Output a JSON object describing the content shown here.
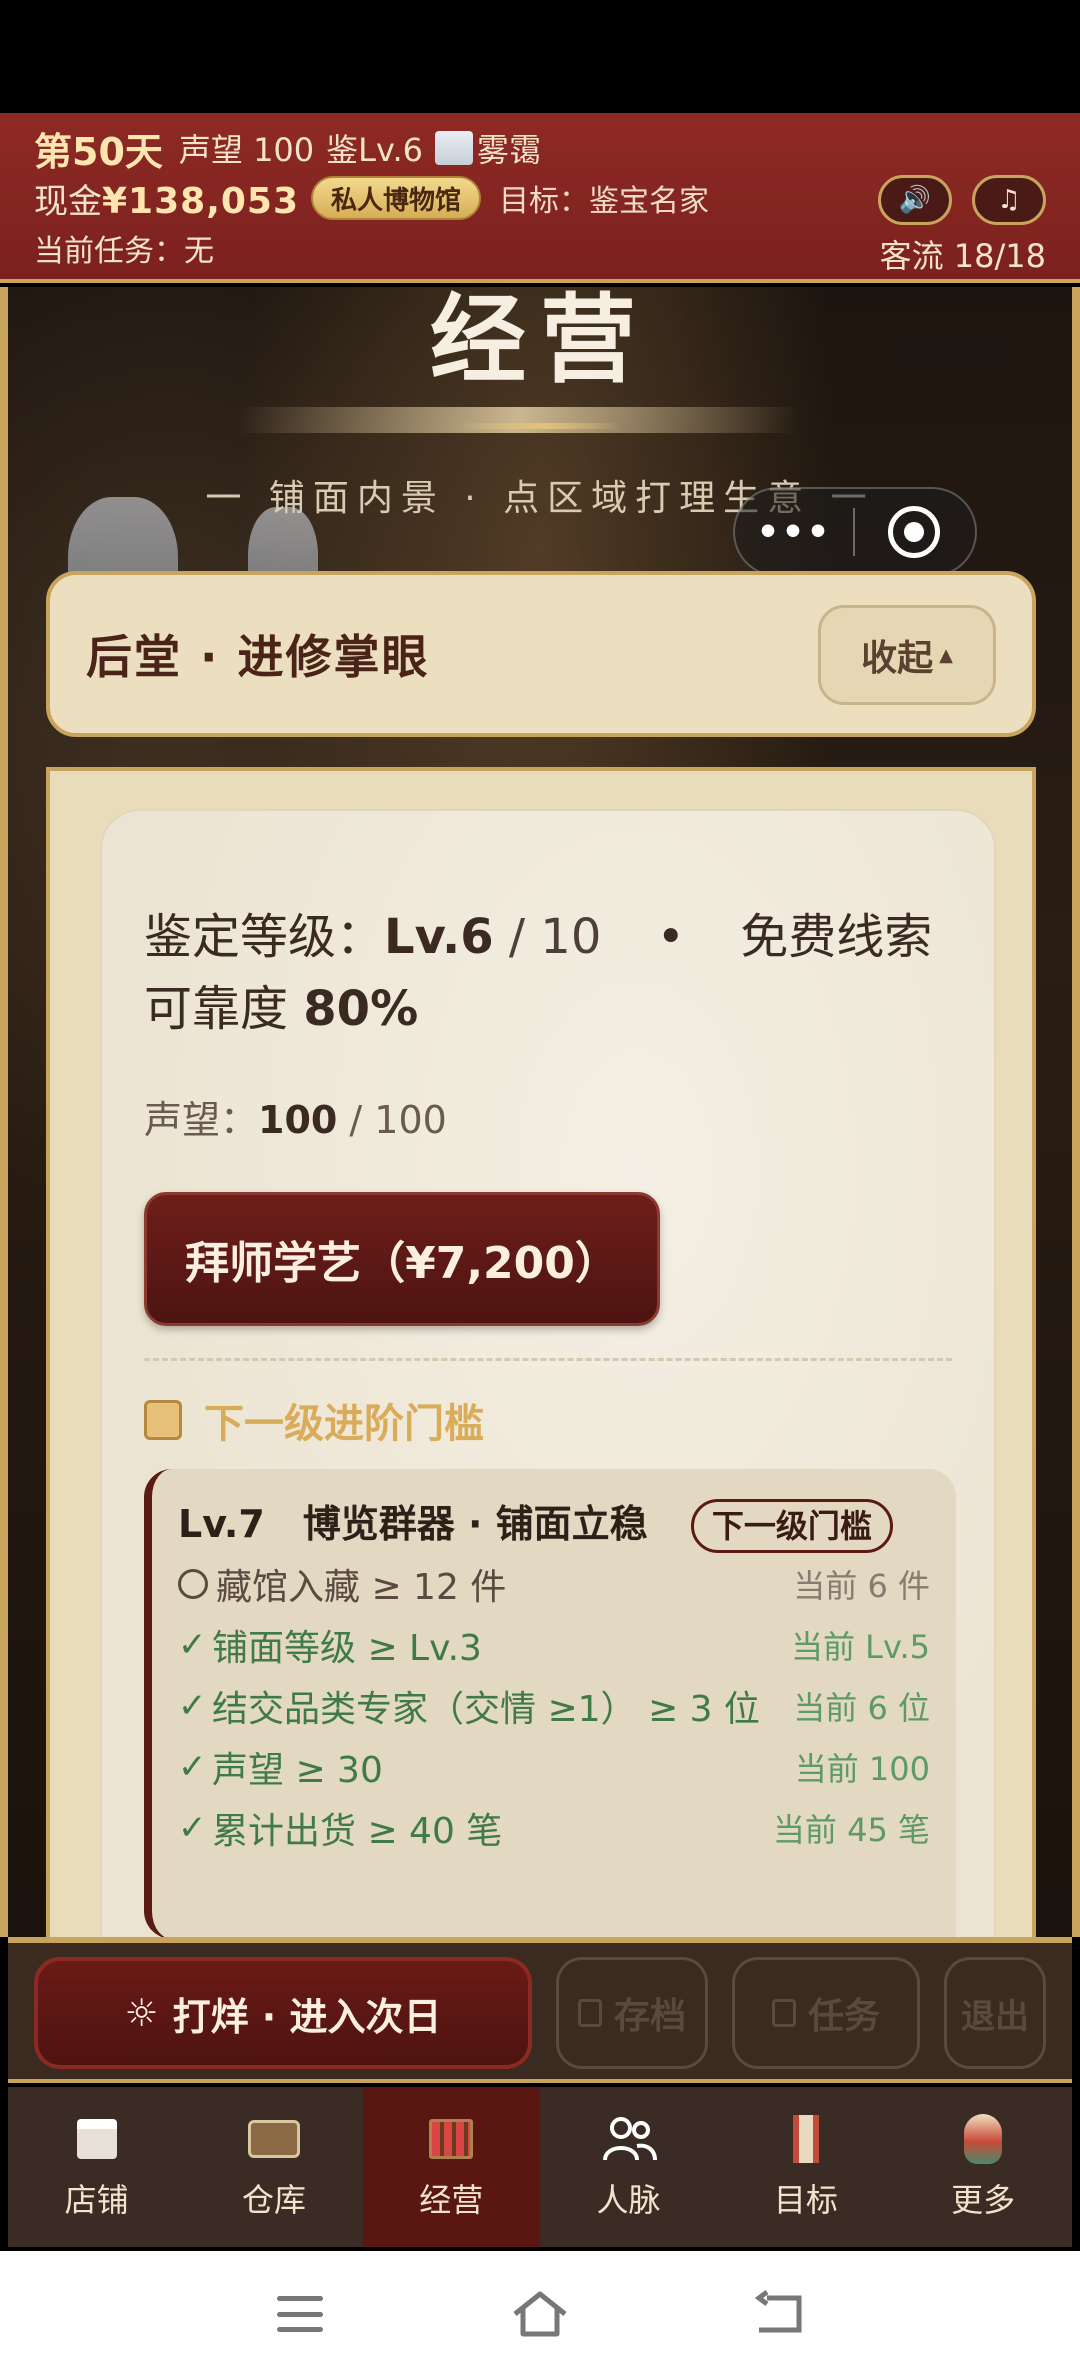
{
  "topbar": {
    "day": "第50天",
    "reputation": "声望 100",
    "appraise_level": "鉴Lv.6",
    "weather": "雾霭",
    "cash_label": "现金",
    "cash_value": "¥138,053",
    "museum_badge": "私人博物馆",
    "goal": "目标：鉴宝名家",
    "task": "当前任务：无",
    "traffic": "客流 18/18",
    "sound_icon": "🔊",
    "music_icon": "♫"
  },
  "scene": {
    "title": "经营",
    "subtitle": "一 铺面内景 · 点区域打理生意 一",
    "capsule_more": "•••"
  },
  "section": {
    "title": "后堂 · 进修掌眼",
    "collapse_label": "收起",
    "collapse_arrow": "▲"
  },
  "card": {
    "level_label": "鉴定等级：",
    "level_value": "Lv.6",
    "level_max": " / 10",
    "bullet": "•",
    "clue": "免费线索",
    "reliability_label": "可靠度 ",
    "reliability_value": "80%",
    "rep_label": "声望：",
    "rep_value": "100",
    "rep_max": " / 100",
    "master_button": "拜师学艺（¥7,200）",
    "next_title": "下一级进阶门槛"
  },
  "threshold": {
    "head": "Lv.7　博览群器 · 铺面立稳",
    "badge": "下一级门槛",
    "requirements": [
      {
        "done": false,
        "label": "藏馆入藏 ≥ 12 件",
        "current": "当前 6 件"
      },
      {
        "done": true,
        "label": "铺面等级 ≥ Lv.3",
        "current": "当前 Lv.5"
      },
      {
        "done": true,
        "label": "结交品类专家（交情 ≥1） ≥ 3 位",
        "current": "当前 6 位"
      },
      {
        "done": true,
        "label": "声望 ≥ 30",
        "current": "当前 100"
      },
      {
        "done": true,
        "label": "累计出货 ≥ 40 笔",
        "current": "当前 45 笔"
      }
    ]
  },
  "actions": {
    "next_day": "打烊 · 进入次日",
    "sun_icon": "☼",
    "save": "存档",
    "tasks": "任务",
    "exit": "退出"
  },
  "tabs": [
    {
      "label": "店铺",
      "icon": "shop-icon"
    },
    {
      "label": "仓库",
      "icon": "warehouse-icon"
    },
    {
      "label": "经营",
      "icon": "abacus-icon",
      "active": true
    },
    {
      "label": "人脉",
      "icon": "people-icon"
    },
    {
      "label": "目标",
      "icon": "scroll-icon"
    },
    {
      "label": "更多",
      "icon": "more-icon"
    }
  ],
  "colors": {
    "topbar": "#8e2a25",
    "gold": "#c9a45c",
    "primary": "#5a1712",
    "ok_green": "#3f7a47"
  }
}
